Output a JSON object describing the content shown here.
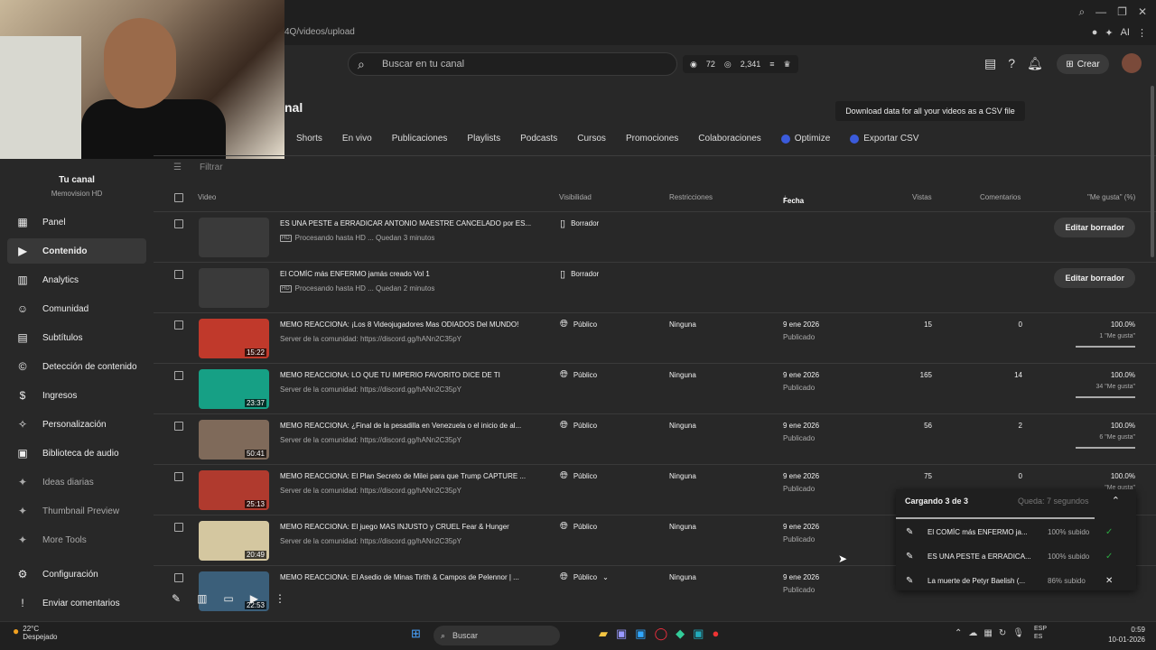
{
  "browser": {
    "url": "4Q/videos/upload",
    "ext_label": "AI"
  },
  "header": {
    "search_placeholder": "Buscar en tu canal",
    "stat_views": "72",
    "stat_subs": "2,341",
    "create_label": "Crear"
  },
  "page": {
    "title": "nal",
    "tooltip": "Download data for all your videos as a CSV file"
  },
  "tabs": [
    "Shorts",
    "En vivo",
    "Publicaciones",
    "Playlists",
    "Podcasts",
    "Cursos",
    "Promociones",
    "Colaboraciones",
    "Optimize",
    "Exportar CSV"
  ],
  "sidebar": {
    "your_channel": "Tu canal",
    "channel_name": "Memovision HD",
    "items": [
      {
        "label": "Panel",
        "icon": "dashboard-icon"
      },
      {
        "label": "Contenido",
        "icon": "content-icon"
      },
      {
        "label": "Analytics",
        "icon": "analytics-icon"
      },
      {
        "label": "Comunidad",
        "icon": "community-icon"
      },
      {
        "label": "Subtítulos",
        "icon": "subtitles-icon"
      },
      {
        "label": "Detección de contenido",
        "icon": "copyright-icon"
      },
      {
        "label": "Ingresos",
        "icon": "money-icon"
      },
      {
        "label": "Personalización",
        "icon": "wand-icon"
      },
      {
        "label": "Biblioteca de audio",
        "icon": "audio-library-icon"
      },
      {
        "label": "Ideas diarias",
        "icon": "ideas-icon"
      },
      {
        "label": "Thumbnail Preview",
        "icon": "thumbnail-icon"
      },
      {
        "label": "More Tools",
        "icon": "tools-icon"
      },
      {
        "label": "Configuración",
        "icon": "gear-icon"
      },
      {
        "label": "Enviar comentarios",
        "icon": "feedback-icon"
      }
    ]
  },
  "table": {
    "filter": "Filtrar",
    "headers": {
      "video": "Video",
      "visibility": "Visibilidad",
      "restrictions": "Restricciones",
      "date": "Fecha",
      "views": "Vistas",
      "comments": "Comentarios",
      "likes": "\"Me gusta\" (%)"
    },
    "rows": [
      {
        "title": "ES UNA PESTE a ERRADICAR ANTONIO MAESTRE CANCELADO por ES...",
        "sub": "Procesando hasta HD ... Quedan 3 minutos",
        "vis": "Borrador",
        "edit": "Editar borrador"
      },
      {
        "title": "El COMÍC más ENFERMO jamás creado Vol 1",
        "sub": "Procesando hasta HD ... Quedan 2 minutos",
        "vis": "Borrador",
        "edit": "Editar borrador"
      },
      {
        "title": "MEMO REACCIONA: ¡Los 8 Videojugadores Mas ODIADOS Del MUNDO!",
        "sub": "Server de la comunidad: https://discord.gg/hANn2C35pY",
        "vis": "Público",
        "rest": "Ninguna",
        "date": "9 ene 2026",
        "pub": "Publicado",
        "views": "15",
        "comments": "0",
        "likes": "100.0%",
        "likesub": "1 \"Me gusta\"",
        "dur": "15:22",
        "color": "#c0392b"
      },
      {
        "title": "MEMO REACCIONA: LO QUE TU IMPERIO FAVORITO DICE DE TI",
        "sub": "Server de la comunidad: https://discord.gg/hANn2C35pY",
        "vis": "Público",
        "rest": "Ninguna",
        "date": "9 ene 2026",
        "pub": "Publicado",
        "views": "165",
        "comments": "14",
        "likes": "100.0%",
        "likesub": "34 \"Me gusta\"",
        "dur": "23:37",
        "color": "#16a085"
      },
      {
        "title": "MEMO REACCIONA: ¿Final de la pesadilla en Venezuela o el inicio de al...",
        "sub": "Server de la comunidad: https://discord.gg/hANn2C35pY",
        "vis": "Público",
        "rest": "Ninguna",
        "date": "9 ene 2026",
        "pub": "Publicado",
        "views": "56",
        "comments": "2",
        "likes": "100.0%",
        "likesub": "6 \"Me gusta\"",
        "dur": "50:41",
        "color": "#7f6a5a"
      },
      {
        "title": "MEMO REACCIONA: El Plan Secreto de Milei para que Trump CAPTURE ...",
        "sub": "Server de la comunidad: https://discord.gg/hANn2C35pY",
        "vis": "Público",
        "rest": "Ninguna",
        "date": "9 ene 2026",
        "pub": "Publicado",
        "views": "75",
        "comments": "0",
        "likes": "100.0%",
        "likesub": "\"Me gusta\"",
        "dur": "25:13",
        "color": "#b03a2e"
      },
      {
        "title": "MEMO REACCIONA: El juego MAS INJUSTO y CRUEL Fear & Hunger",
        "sub": "Server de la comunidad: https://discord.gg/hANn2C35pY",
        "vis": "Público",
        "rest": "Ninguna",
        "date": "9 ene 2026",
        "pub": "Publicado",
        "views": "",
        "comments": "",
        "likes": "",
        "likesub": "",
        "dur": "20:49",
        "color": "#d4c7a0"
      },
      {
        "title": "MEMO REACCIONA: El Asedio de Minas Tirith & Campos de Pelennor | ...",
        "sub": "",
        "vis": "Público",
        "rest": "Ninguna",
        "date": "9 ene 2026",
        "pub": "Publicado",
        "views": "",
        "comments": "",
        "likes": "",
        "likesub": "",
        "dur": "22:53",
        "color": "#3b5f7a"
      }
    ]
  },
  "upload_panel": {
    "title": "Cargando 3 de 3",
    "remaining": "Queda: 7 segundos",
    "items": [
      {
        "name": "El COMÍC más ENFERMO ja...",
        "progress": "100% subido",
        "status": "✓"
      },
      {
        "name": "ES UNA PESTE a ERRADICA...",
        "progress": "100% subido",
        "status": "✓"
      },
      {
        "name": "La muerte de Petyr Baelish (...",
        "progress": "86% subido",
        "status": "✕"
      }
    ]
  },
  "taskbar": {
    "temp": "22°C",
    "weather": "Despejado",
    "search": "Buscar",
    "lang1": "ESP",
    "lang2": "ES",
    "time": "0:59",
    "date": "10-01-2026"
  }
}
